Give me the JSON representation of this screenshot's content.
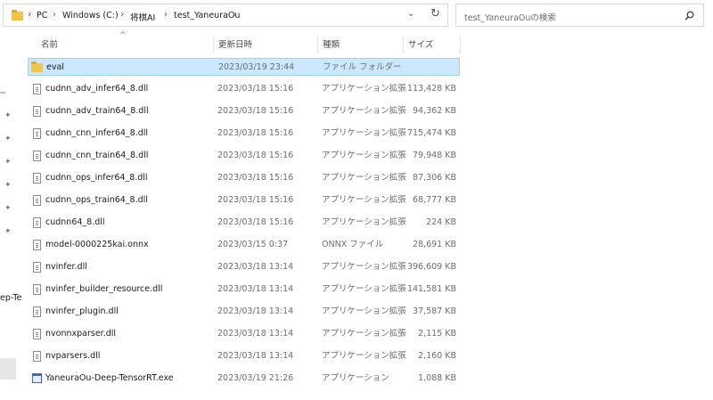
{
  "address": {
    "crumbs": [
      "PC",
      "Windows (C:)",
      "将棋AI",
      "test_YaneuraOu"
    ]
  },
  "search": {
    "placeholder": "test_YaneuraOuの検索"
  },
  "columns": {
    "name": "名前",
    "date": "更新日時",
    "type": "種類",
    "size": "サイズ"
  },
  "sidebar": {
    "partial_label": "ep-Te"
  },
  "files": [
    {
      "name": "eval",
      "date": "2023/03/19 23:44",
      "type": "ファイル フォルダー",
      "size": "",
      "icon": "folder-icon",
      "selected": true
    },
    {
      "name": "cudnn_adv_infer64_8.dll",
      "date": "2023/03/18 15:16",
      "type": "アプリケーション拡張",
      "size": "113,428 KB",
      "icon": "file-icon"
    },
    {
      "name": "cudnn_adv_train64_8.dll",
      "date": "2023/03/18 15:16",
      "type": "アプリケーション拡張",
      "size": "94,362 KB",
      "icon": "file-icon"
    },
    {
      "name": "cudnn_cnn_infer64_8.dll",
      "date": "2023/03/18 15:16",
      "type": "アプリケーション拡張",
      "size": "715,474 KB",
      "icon": "file-icon"
    },
    {
      "name": "cudnn_cnn_train64_8.dll",
      "date": "2023/03/18 15:16",
      "type": "アプリケーション拡張",
      "size": "79,948 KB",
      "icon": "file-icon"
    },
    {
      "name": "cudnn_ops_infer64_8.dll",
      "date": "2023/03/18 15:16",
      "type": "アプリケーション拡張",
      "size": "87,306 KB",
      "icon": "file-icon"
    },
    {
      "name": "cudnn_ops_train64_8.dll",
      "date": "2023/03/18 15:16",
      "type": "アプリケーション拡張",
      "size": "68,777 KB",
      "icon": "file-icon"
    },
    {
      "name": "cudnn64_8.dll",
      "date": "2023/03/18 15:16",
      "type": "アプリケーション拡張",
      "size": "224 KB",
      "icon": "file-icon"
    },
    {
      "name": "model-0000225kai.onnx",
      "date": "2023/03/15 0:37",
      "type": "ONNX ファイル",
      "size": "28,691 KB",
      "icon": "file-icon"
    },
    {
      "name": "nvinfer.dll",
      "date": "2023/03/18 13:14",
      "type": "アプリケーション拡張",
      "size": "396,609 KB",
      "icon": "file-icon"
    },
    {
      "name": "nvinfer_builder_resource.dll",
      "date": "2023/03/18 13:14",
      "type": "アプリケーション拡張",
      "size": "141,581 KB",
      "icon": "file-icon"
    },
    {
      "name": "nvinfer_plugin.dll",
      "date": "2023/03/18 13:14",
      "type": "アプリケーション拡張",
      "size": "37,587 KB",
      "icon": "file-icon"
    },
    {
      "name": "nvonnxparser.dll",
      "date": "2023/03/18 13:14",
      "type": "アプリケーション拡張",
      "size": "2,115 KB",
      "icon": "file-icon"
    },
    {
      "name": "nvparsers.dll",
      "date": "2023/03/18 13:14",
      "type": "アプリケーション拡張",
      "size": "2,160 KB",
      "icon": "file-icon"
    },
    {
      "name": "YaneuraOu-Deep-TensorRT.exe",
      "date": "2023/03/19 21:26",
      "type": "アプリケーション",
      "size": "1,088 KB",
      "icon": "exe-icon"
    }
  ]
}
